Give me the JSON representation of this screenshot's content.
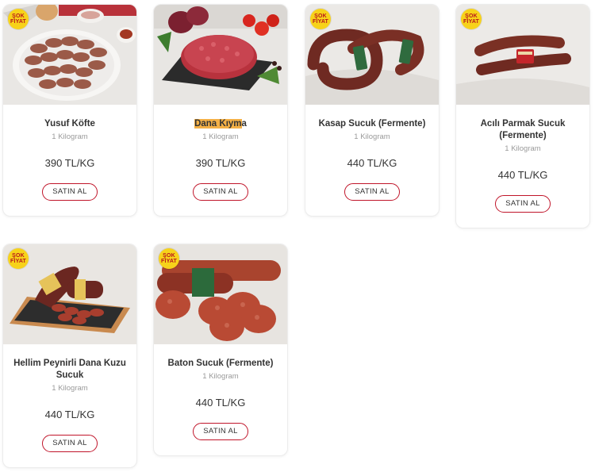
{
  "badge": {
    "line1": "ŞOK",
    "line2": "FİYAT"
  },
  "colors": {
    "accent": "#c0152a",
    "badge_bg": "#f7d21a",
    "badge_text": "#b8151b",
    "highlight": "#f4b046"
  },
  "products": [
    {
      "title": "Yusuf Köfte",
      "unit": "1 Kilogram",
      "price": "390 TL/KG",
      "button": "SATIN AL",
      "image": "meatballs-plate"
    },
    {
      "title_hl": "Dana Kıym",
      "title_rest": "a",
      "unit": "1 Kilogram",
      "price": "390 TL/KG",
      "button": "SATIN AL",
      "image": "ground-beef"
    },
    {
      "title": "Kasap Sucuk (Fermente)",
      "unit": "1 Kilogram",
      "price": "440 TL/KG",
      "button": "SATIN AL",
      "image": "sausage-ring"
    },
    {
      "title": "Acılı Parmak Sucuk (Fermente)",
      "unit": "1 Kilogram",
      "price": "440 TL/KG",
      "button": "SATIN AL",
      "image": "finger-sausage"
    },
    {
      "title": "Hellim Peynirli Dana Kuzu Sucuk",
      "unit": "1 Kilogram",
      "price": "440 TL/KG",
      "button": "SATIN AL",
      "image": "sliced-sausage-board"
    },
    {
      "title": "Baton Sucuk (Fermente)",
      "unit": "1 Kilogram",
      "price": "440 TL/KG",
      "button": "SATIN AL",
      "image": "baton-sausage"
    }
  ]
}
